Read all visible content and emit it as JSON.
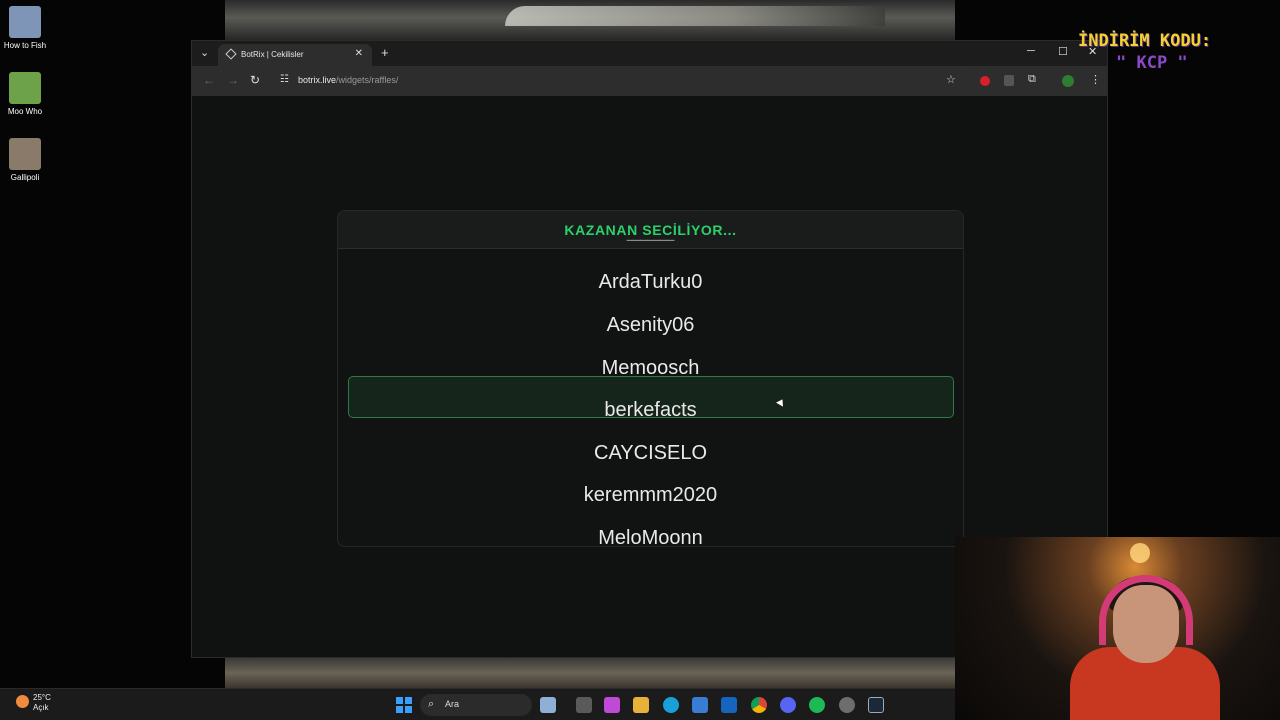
{
  "desktop": {
    "icons": [
      {
        "label": "How to Fish",
        "icon": "fish-game-icon",
        "color": "#7f95b8"
      },
      {
        "label": "Moo Who",
        "icon": "moo-who-icon",
        "color": "#6da24a"
      },
      {
        "label": "Gallipoli",
        "icon": "gallipoli-icon",
        "color": "#8a7a6a"
      }
    ]
  },
  "browser": {
    "tab_title": "BotRix | Cekilisler",
    "url_domain": "botrix.live",
    "url_path": "/widgets/raffles/"
  },
  "raffle": {
    "header": "KAZANAN SECİLİYOR...",
    "accent_color": "#2bd16b",
    "names": [
      "ArdaTurku0",
      "Asenity06",
      "Memoosch",
      "berkefacts",
      "CAYCISELO",
      "keremmm2020",
      "MeloMoonn"
    ],
    "selected": "berkefacts"
  },
  "overlay": {
    "promo_title": "İNDİRİM KODU:",
    "promo_code": "\" KCP \""
  },
  "taskbar": {
    "temperature": "25°C",
    "weather_text": "Açık",
    "search_label": "Ara",
    "apps": [
      "windows-start-icon",
      "search-icon",
      "task-view-icon",
      "file-explorer-icon",
      "copilot-icon",
      "folder-icon",
      "edge-icon",
      "store-icon",
      "outlook-icon",
      "chrome-icon",
      "discord-icon",
      "spotify-icon",
      "settings-icon",
      "steam-icon"
    ]
  }
}
